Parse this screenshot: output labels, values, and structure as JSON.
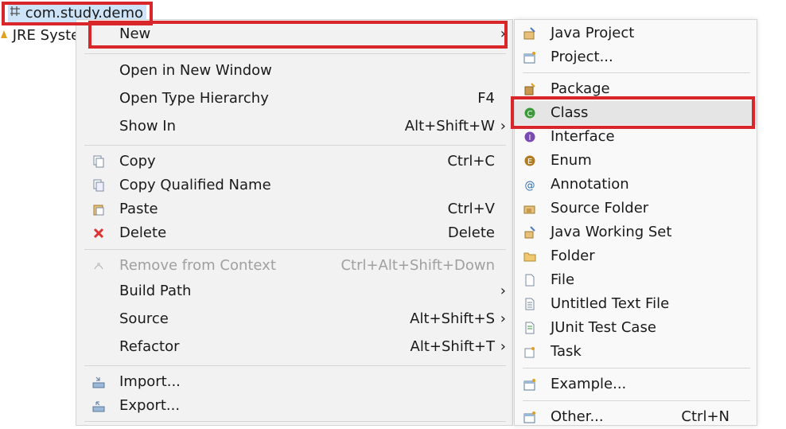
{
  "tree": {
    "package_name": "com.study.demo",
    "jre_label": "JRE Syster"
  },
  "context_menu": {
    "new": {
      "label": "New"
    },
    "open_new_window": {
      "label": "Open in New Window"
    },
    "open_type_hierarchy": {
      "label": "Open Type Hierarchy",
      "shortcut": "F4"
    },
    "show_in": {
      "label": "Show In",
      "shortcut": "Alt+Shift+W"
    },
    "copy": {
      "label": "Copy",
      "shortcut": "Ctrl+C"
    },
    "copy_qualified": {
      "label": "Copy Qualified Name"
    },
    "paste": {
      "label": "Paste",
      "shortcut": "Ctrl+V"
    },
    "delete": {
      "label": "Delete",
      "shortcut": "Delete"
    },
    "remove_context": {
      "label": "Remove from Context",
      "shortcut": "Ctrl+Alt+Shift+Down"
    },
    "build_path": {
      "label": "Build Path"
    },
    "source": {
      "label": "Source",
      "shortcut": "Alt+Shift+S"
    },
    "refactor": {
      "label": "Refactor",
      "shortcut": "Alt+Shift+T"
    },
    "import": {
      "label": "Import..."
    },
    "export": {
      "label": "Export..."
    }
  },
  "submenu": {
    "java_project": "Java Project",
    "project": "Project...",
    "package": "Package",
    "class": "Class",
    "interface": "Interface",
    "enum": "Enum",
    "annotation": "Annotation",
    "source_folder": "Source Folder",
    "java_working_set": "Java Working Set",
    "folder": "Folder",
    "file": "File",
    "untitled_text_file": "Untitled Text File",
    "junit_test_case": "JUnit Test Case",
    "task": "Task",
    "example": "Example...",
    "other": {
      "label": "Other...",
      "shortcut": "Ctrl+N"
    }
  },
  "arrow_glyph": "›",
  "colors": {
    "highlight_border": "#d9262a",
    "selection": "#cde3f7"
  }
}
